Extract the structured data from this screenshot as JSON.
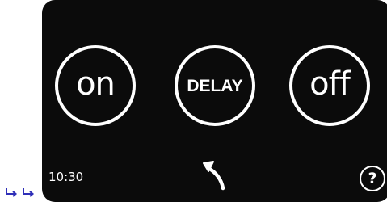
{
  "side_arrows": [
    {
      "icon": "return-arrow-icon",
      "color": "#2f2fb8"
    },
    {
      "icon": "return-arrow-icon",
      "color": "#2f2fb8"
    }
  ],
  "panel": {
    "background": "#0b0b0b"
  },
  "buttons": {
    "on_label": "on",
    "delay_label": "DELAY",
    "off_label": "off"
  },
  "status": {
    "time": "10:30"
  },
  "navigation": {
    "back_icon": "back-arrow-icon",
    "help_label": "?"
  }
}
